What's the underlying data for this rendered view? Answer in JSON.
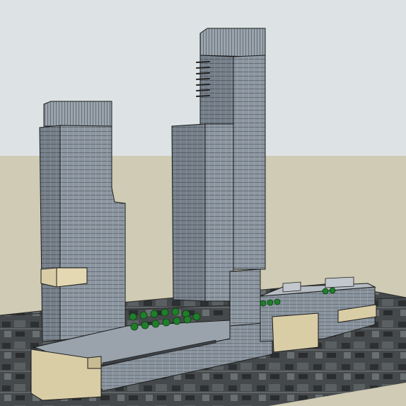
{
  "viewport": {
    "sky_color": "#dde3e5",
    "ground_color": "#cfcbb4",
    "aerial_base_color": "#3c4042",
    "glass_color": "#8d97a1",
    "glass_dark_color": "#6f7780",
    "stone_color": "#d9cda6",
    "tree_color": "#1f7f2a",
    "edge_color": "#1c1c1c"
  },
  "scene": {
    "objects": [
      "left-tower",
      "right-tower",
      "podium",
      "rooftop-trees-left",
      "rooftop-trees-right",
      "aerial-photo-ground"
    ]
  }
}
